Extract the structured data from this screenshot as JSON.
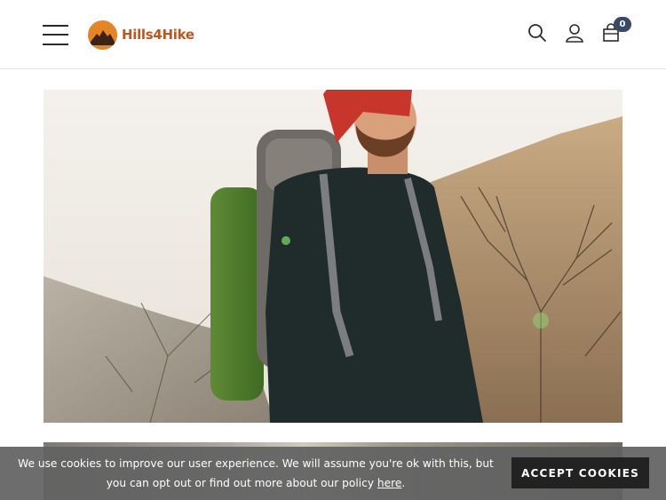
{
  "header": {
    "logo_text": "Hills4Hike",
    "cart_count": "0"
  },
  "hero": {
    "image": "hiker-with-backpack-photo"
  },
  "cookie_banner": {
    "text_before_link": "We use cookies to improve our user experience. We will assume you're ok with this, but you can opt out or find out more about our policy ",
    "link_text": "here",
    "text_after_link": ".",
    "accept_label": "ACCEPT COOKIES"
  },
  "colors": {
    "brand_orange": "#e58524",
    "logo_text": "#c0561c",
    "badge": "#3a4a66",
    "cookie_bg": "#626262",
    "button_bg": "#222222"
  }
}
